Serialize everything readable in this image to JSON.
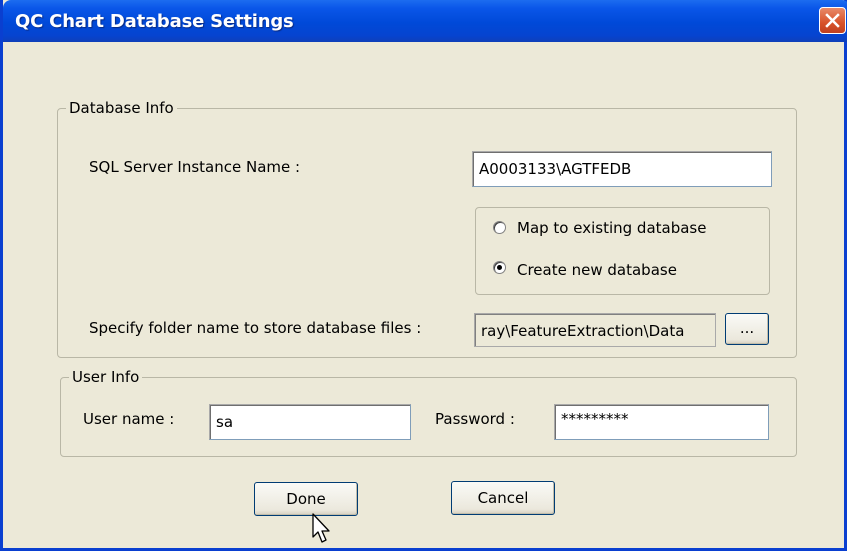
{
  "window": {
    "title": "QC Chart Database Settings"
  },
  "database_info": {
    "group_label": "Database Info",
    "instance_label": "SQL Server Instance Name :",
    "instance_value": "A0003133\\AGTFEDB",
    "options": [
      {
        "label": "Map to existing database",
        "selected": false
      },
      {
        "label": "Create new database",
        "selected": true
      }
    ],
    "folder_label": "Specify folder name to store database files :",
    "folder_value": "ray\\FeatureExtraction\\Data",
    "browse_label": "..."
  },
  "user_info": {
    "group_label": "User Info",
    "username_label": "User name :",
    "username_value": "sa",
    "password_label": "Password :",
    "password_value": "*********"
  },
  "buttons": {
    "done": "Done",
    "cancel": "Cancel"
  },
  "colors": {
    "title_bar": "#0049d8",
    "dialog_bg": "#ece9d8",
    "close_button": "#d8522a"
  }
}
